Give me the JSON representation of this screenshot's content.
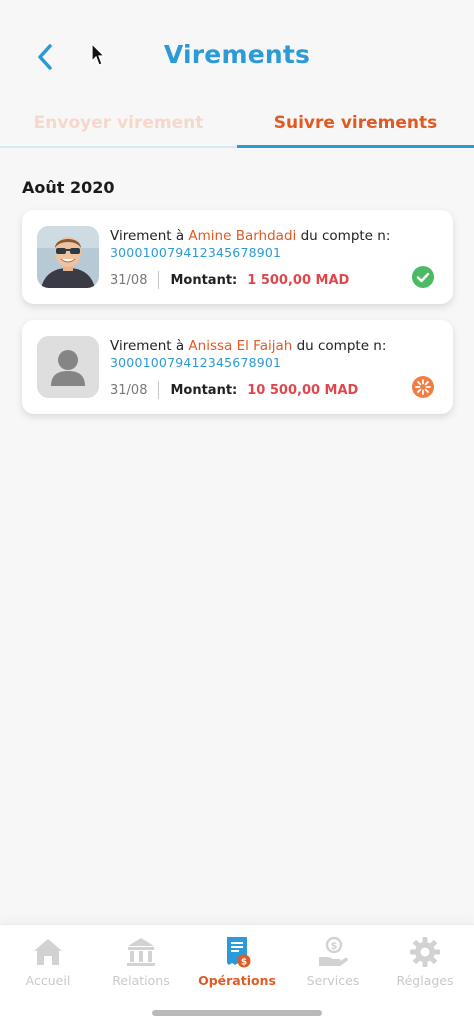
{
  "header": {
    "title": "Virements",
    "back_icon": "chevron-left-icon"
  },
  "tabs": [
    {
      "label": "Envoyer virement",
      "active": false
    },
    {
      "label": "Suivre virements",
      "active": true
    }
  ],
  "section": {
    "title": "Août 2020"
  },
  "transfers": [
    {
      "prefix": "Virement à ",
      "name": "Amine Barhdadi",
      "suffix": " du compte n:",
      "account": "3000100794123456789​01",
      "date": "31/08",
      "amount_label": "Montant:",
      "amount": "1 500,00 MAD",
      "status_icon": "check-circle-icon",
      "status_color": "#4cb963"
    },
    {
      "prefix": "Virement à ",
      "name": "Anissa El Faijah",
      "suffix": " du compte n:",
      "account": "300010079412345678901",
      "date": "31/08",
      "amount_label": "Montant:",
      "amount": "10 500,00 MAD",
      "status_icon": "pending-spinner-icon",
      "status_color": "#f07f45"
    }
  ],
  "bottom_nav": [
    {
      "label": "Accueil",
      "icon": "home-icon",
      "active": false
    },
    {
      "label": "Relations",
      "icon": "bank-icon",
      "active": false
    },
    {
      "label": "Opérations",
      "icon": "receipt-icon",
      "active": true
    },
    {
      "label": "Services",
      "icon": "hand-coin-icon",
      "active": false
    },
    {
      "label": "Réglages",
      "icon": "gear-icon",
      "active": false
    }
  ],
  "colors": {
    "primary": "#2b9ad6",
    "accent": "#e05a24",
    "amount": "#e0474c"
  }
}
